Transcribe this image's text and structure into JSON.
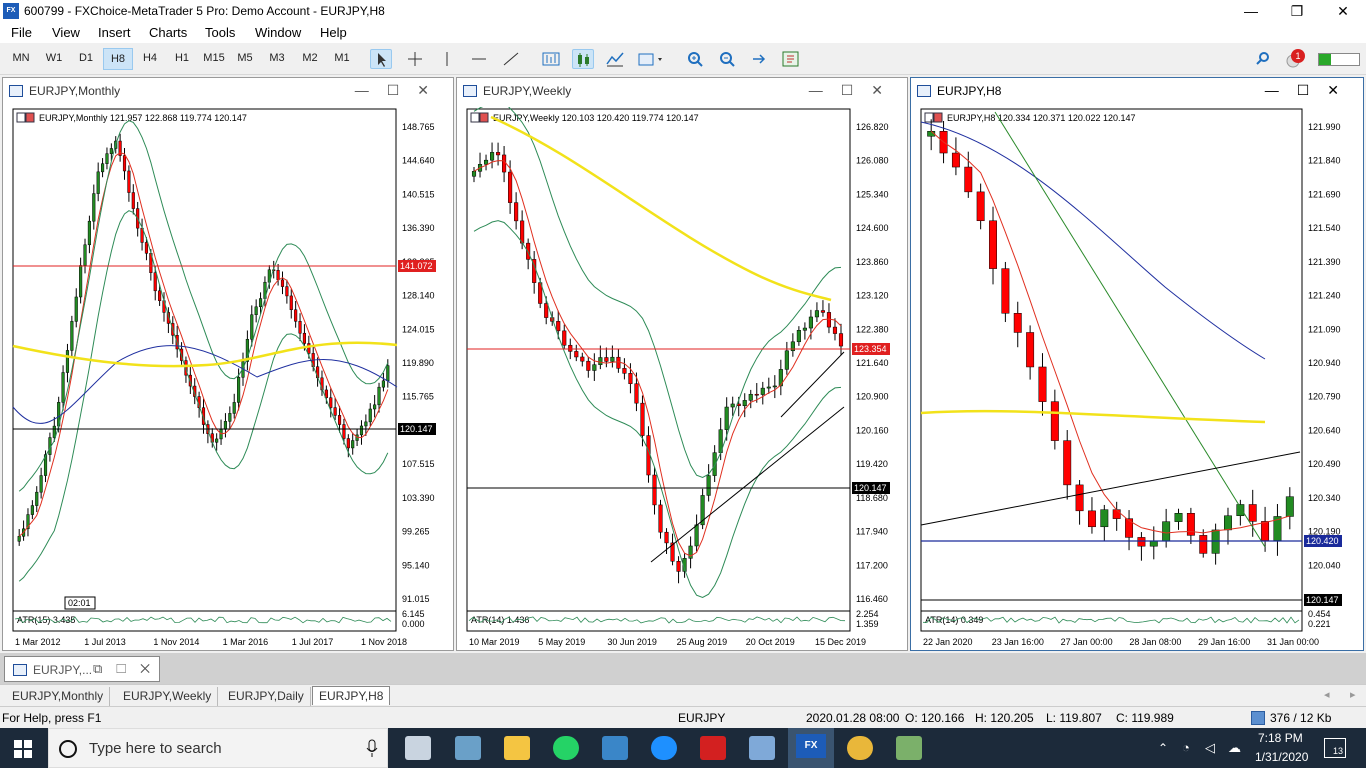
{
  "window": {
    "title": "600799 - FXChoice-MetaTrader 5 Pro: Demo Account - EURJPY,H8",
    "minimize": "—",
    "maximize": "❐",
    "close": "✕"
  },
  "menu": [
    "File",
    "View",
    "Insert",
    "Charts",
    "Tools",
    "Window",
    "Help"
  ],
  "timeframes": [
    "MN",
    "W1",
    "D1",
    "H8",
    "H4",
    "H1",
    "M15",
    "M5",
    "M3",
    "M2",
    "M1"
  ],
  "active_timeframe": "H8",
  "notification_count": "1",
  "charts": [
    {
      "window_title": "EURJPY,Monthly",
      "header": "EURJPY,Monthly  121.957 122.868 119.774 120.147",
      "y_ticks": [
        "148.765",
        "144.640",
        "140.515",
        "136.390",
        "132.265",
        "128.140",
        "124.015",
        "119.890",
        "115.765",
        "111.640",
        "107.515",
        "103.390",
        "99.265",
        "95.140",
        "91.015"
      ],
      "x_ticks": [
        "1 Mar 2012",
        "1 Jul 2013",
        "1 Nov 2014",
        "1 Mar 2016",
        "1 Jul 2017",
        "1 Nov 2018"
      ],
      "red_line_label": "141.072",
      "price_label": "120.147",
      "indicator": "ATR(15) 3.435",
      "indicator_ticks": [
        "6.145",
        "0.000"
      ],
      "crosshair_label": "02:01"
    },
    {
      "window_title": "EURJPY,Weekly",
      "header": "EURJPY,Weekly  120.103 120.420 119.774 120.147",
      "y_ticks": [
        "126.820",
        "126.080",
        "125.340",
        "124.600",
        "123.860",
        "123.120",
        "122.380",
        "121.640",
        "120.900",
        "120.160",
        "119.420",
        "118.680",
        "117.940",
        "117.200",
        "116.460"
      ],
      "x_ticks": [
        "10 Mar 2019",
        "5 May 2019",
        "30 Jun 2019",
        "25 Aug 2019",
        "20 Oct 2019",
        "15 Dec 2019"
      ],
      "red_line_label": "123.354",
      "price_label": "120.147",
      "indicator": "ATR(14) 1.436",
      "indicator_ticks": [
        "2.254",
        "1.359"
      ]
    },
    {
      "window_title": "EURJPY,H8",
      "header": "EURJPY,H8  120.334 120.371 120.022 120.147",
      "y_ticks": [
        "121.990",
        "121.840",
        "121.690",
        "121.540",
        "121.390",
        "121.240",
        "121.090",
        "120.940",
        "120.790",
        "120.640",
        "120.490",
        "120.340",
        "120.190",
        "120.040",
        "119.890"
      ],
      "x_ticks": [
        "22 Jan 2020",
        "23 Jan 16:00",
        "27 Jan 00:00",
        "28 Jan 08:00",
        "29 Jan 16:00",
        "31 Jan 00:00"
      ],
      "blue_line_label": "120.420",
      "price_label": "120.147",
      "indicator": "ATR(14) 0.349",
      "indicator_ticks": [
        "0.454",
        "0.221"
      ]
    }
  ],
  "minimized_window": "EURJPY,...",
  "tabs": [
    "EURJPY,Monthly",
    "EURJPY,Weekly",
    "EURJPY,Daily",
    "EURJPY,H8"
  ],
  "active_tab": "EURJPY,H8",
  "status": {
    "help": "For Help, press F1",
    "symbol": "EURJPY",
    "datetime": "2020.01.28 08:00",
    "open": "O: 120.166",
    "high": "H: 120.205",
    "low": "L: 119.807",
    "close": "C: 119.989",
    "traffic": "376 / 12 Kb"
  },
  "taskbar": {
    "search_placeholder": "Type here to search",
    "time": "7:18 PM",
    "date": "1/31/2020",
    "notifications": "13"
  },
  "colors": {
    "bull": "#228b22",
    "bear": "#ff0000",
    "ma_yellow": "#f2e21a",
    "bands": "#2e8b57",
    "ma_red": "#e03020",
    "ma_blue": "#2030a0"
  }
}
